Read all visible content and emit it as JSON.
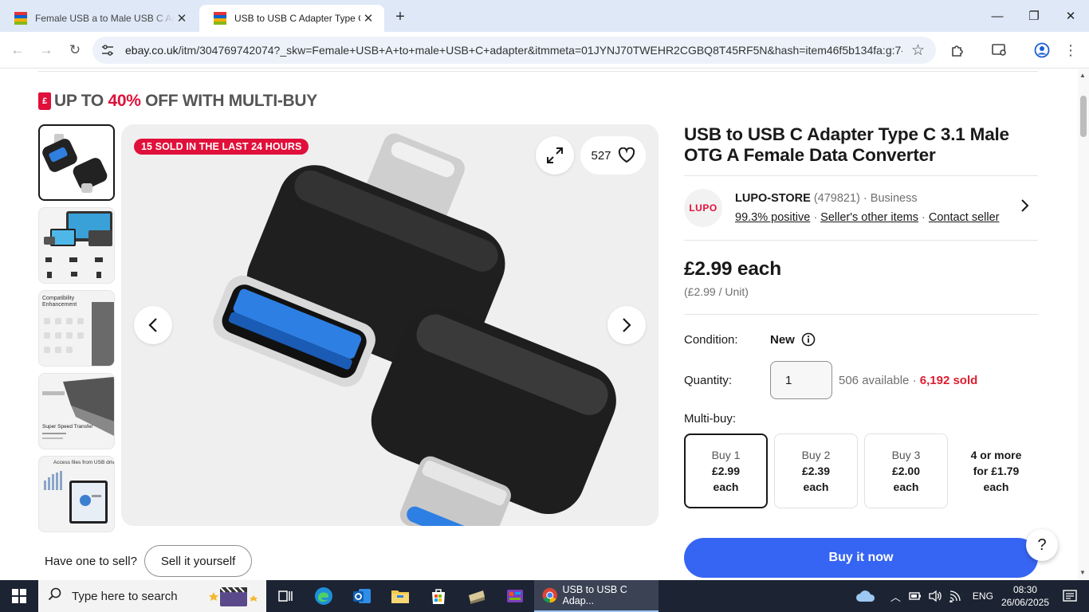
{
  "browser": {
    "tabs": [
      {
        "title": "Female USB a to Male USB C Ad",
        "active": false
      },
      {
        "title": "USB to USB C Adapter Type C 3",
        "active": true
      }
    ],
    "url_domain": "ebay.co.uk",
    "url_rest": "/itm/304769742074?_skw=Female+USB+A+to+male+USB+C+adapter&itmmeta=01JYNJ70TWEHR2CGBQ8T45RF5N&hash=item46f5b134fa:g:7-..."
  },
  "promo": {
    "prefix": "UP TO",
    "percent": "40%",
    "suffix": "OFF WITH MULTI-BUY"
  },
  "gallery": {
    "sold_badge": "15 SOLD IN THE LAST 24 HOURS",
    "watch_count": "527"
  },
  "thumbs": [
    {
      "caption": ""
    },
    {
      "caption": ""
    },
    {
      "caption": "Compatibility Enhancement"
    },
    {
      "caption": "Super Speed Transfer"
    },
    {
      "caption": "Access files from USB drive"
    }
  ],
  "sell": {
    "question": "Have one to sell?",
    "button": "Sell it yourself"
  },
  "product": {
    "title": "USB to USB C Adapter Type C 3.1 Male OTG A Female Data Converter",
    "seller_logo": "LUPO",
    "seller_name": "LUPO-STORE",
    "seller_feedback": "(479821)",
    "seller_type": "Business",
    "positive": "99.3% positive",
    "other_items": "Seller's other items",
    "contact": "Contact seller",
    "price": "£2.99 each",
    "unit_price": "(£2.99 / Unit)",
    "condition_label": "Condition:",
    "condition": "New",
    "quantity_label": "Quantity:",
    "quantity": "1",
    "available": "506 available",
    "sold": "6,192 sold",
    "multibuy_label": "Multi-buy:",
    "multibuy": [
      {
        "qty": "Buy 1",
        "price": "£2.99",
        "each": "each"
      },
      {
        "qty": "Buy 2",
        "price": "£2.39",
        "each": "each"
      },
      {
        "qty": "Buy 3",
        "price": "£2.00",
        "each": "each"
      },
      {
        "qty": "4 or more",
        "price": "for £1.79",
        "each": "each"
      }
    ],
    "buy_now": "Buy it now"
  },
  "taskbar": {
    "search_placeholder": "Type here to search",
    "chrome_task": "USB to USB C Adap...",
    "lang": "ENG",
    "time": "08:30",
    "date": "26/06/2025"
  },
  "colors": {
    "ebay_red": "#e0103a",
    "buy_blue": "#3665f3"
  }
}
